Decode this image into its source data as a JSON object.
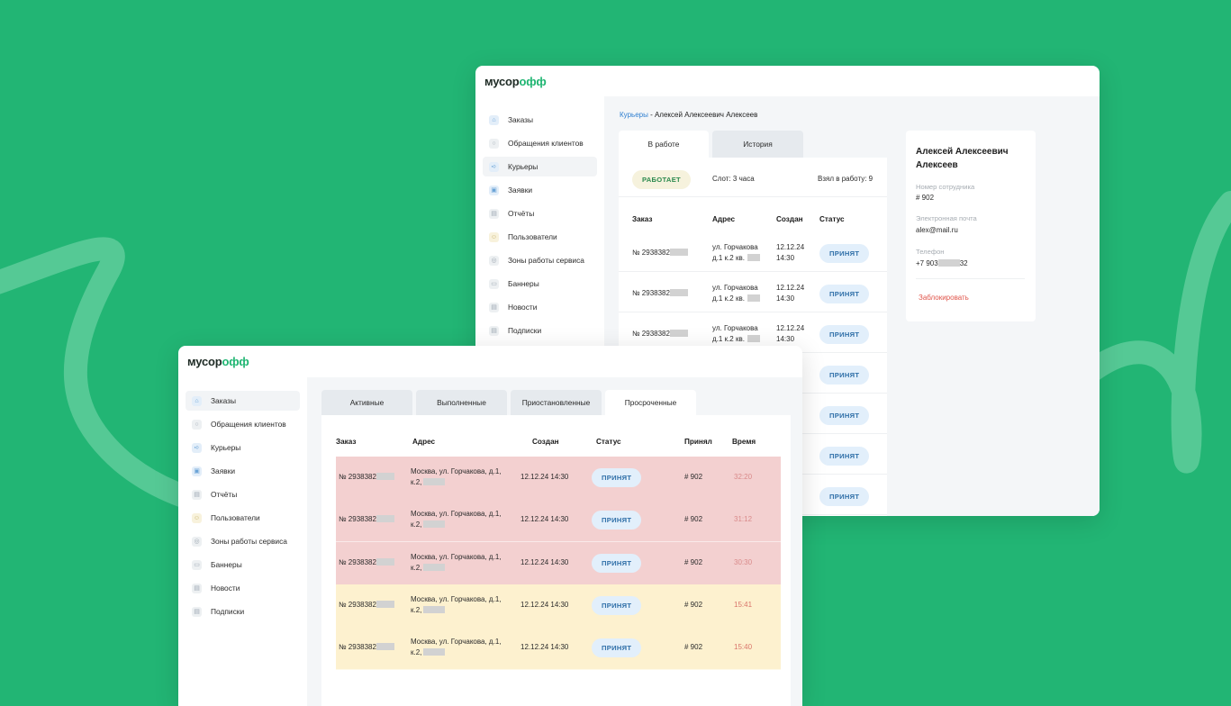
{
  "colors": {
    "background": "#22b574",
    "accent": "#1fb572",
    "link": "#2f7fd0",
    "badge_bg": "#e2effb",
    "overdue_red": "#f3d0d0",
    "overdue_yellow": "#fdf1cf",
    "danger": "#e0544a"
  },
  "logo": {
    "part1": "мусор",
    "part2": "офф"
  },
  "sidebar": {
    "items": [
      {
        "label": "Заказы",
        "icon": "orders-icon"
      },
      {
        "label": "Обращения клиентов",
        "icon": "chat-icon"
      },
      {
        "label": "Курьеры",
        "icon": "courier-icon"
      },
      {
        "label": "Заявки",
        "icon": "requests-icon"
      },
      {
        "label": "Отчёты",
        "icon": "reports-icon"
      },
      {
        "label": "Пользователи",
        "icon": "users-icon"
      },
      {
        "label": "Зоны работы сервиса",
        "icon": "zones-icon"
      },
      {
        "label": "Баннеры",
        "icon": "banners-icon"
      },
      {
        "label": "Новости",
        "icon": "news-icon"
      },
      {
        "label": "Подписки",
        "icon": "subscriptions-icon"
      }
    ]
  },
  "courier_window": {
    "breadcrumb": {
      "parent": "Курьеры",
      "separator": " - ",
      "current": "Алексей Алексеевич Алексеев"
    },
    "tabs": [
      {
        "label": "В работе"
      },
      {
        "label": "История"
      }
    ],
    "status_badge": "РАБОТАЕТ",
    "slot": "Слот: 3 часа",
    "taken": "Взял в работу: 9",
    "columns": [
      "Заказ",
      "Адрес",
      "Создан",
      "Статус"
    ],
    "rows": [
      {
        "order": "№ 2938382",
        "addr1": "ул. Горчакова",
        "addr2": "д.1 к.2 кв.",
        "date": "12.12.24",
        "time": "14:30",
        "status": "ПРИНЯТ"
      },
      {
        "order": "№ 2938382",
        "addr1": "ул. Горчакова",
        "addr2": "д.1 к.2 кв.",
        "date": "12.12.24",
        "time": "14:30",
        "status": "ПРИНЯТ"
      },
      {
        "order": "№ 2938382",
        "addr1": "ул. Горчакова",
        "addr2": "д.1 к.2 кв.",
        "date": "12.12.24",
        "time": "14:30",
        "status": "ПРИНЯТ"
      }
    ],
    "hidden_row_statuses": [
      "ПРИНЯТ",
      "ПРИНЯТ",
      "ПРИНЯТ",
      "ПРИНЯТ"
    ],
    "profile": {
      "name_line1": "Алексей Алексеевич",
      "name_line2": "Алексеев",
      "employee_label": "Номер сотрудника",
      "employee_value": "# 902",
      "email_label": "Электронная почта",
      "email_value": "alex@mail.ru",
      "phone_label": "Телефон",
      "phone_prefix": "+7 903",
      "phone_suffix": "32",
      "block_label": "Заблокировать"
    }
  },
  "orders_window": {
    "tabs": [
      {
        "label": "Активные"
      },
      {
        "label": "Выполненные"
      },
      {
        "label": "Приостановленные"
      },
      {
        "label": "Просроченные"
      }
    ],
    "columns": [
      "Заказ",
      "Адрес",
      "Создан",
      "Статус",
      "Принял",
      "Время"
    ],
    "rows": [
      {
        "order": "№ 2938382",
        "addr1": "Москва, ул. Горчакова, д.1,",
        "addr2": "к.2,",
        "created": "12.12.24 14:30",
        "status": "ПРИНЯТ",
        "accepted": "# 902",
        "time": "32:20",
        "tone": "red"
      },
      {
        "order": "№ 2938382",
        "addr1": "Москва, ул. Горчакова, д.1,",
        "addr2": "к.2,",
        "created": "12.12.24 14:30",
        "status": "ПРИНЯТ",
        "accepted": "# 902",
        "time": "31:12",
        "tone": "red"
      },
      {
        "order": "№ 2938382",
        "addr1": "Москва, ул. Горчакова, д.1,",
        "addr2": "к.2,",
        "created": "12.12.24 14:30",
        "status": "ПРИНЯТ",
        "accepted": "# 902",
        "time": "30:30",
        "tone": "red"
      },
      {
        "order": "№ 2938382",
        "addr1": "Москва, ул. Горчакова, д.1,",
        "addr2": "к.2,",
        "created": "12.12.24 14:30",
        "status": "ПРИНЯТ",
        "accepted": "# 902",
        "time": "15:41",
        "tone": "yellow"
      },
      {
        "order": "№ 2938382",
        "addr1": "Москва, ул. Горчакова, д.1,",
        "addr2": "к.2,",
        "created": "12.12.24 14:30",
        "status": "ПРИНЯТ",
        "accepted": "# 902",
        "time": "15:40",
        "tone": "yellow"
      }
    ]
  }
}
